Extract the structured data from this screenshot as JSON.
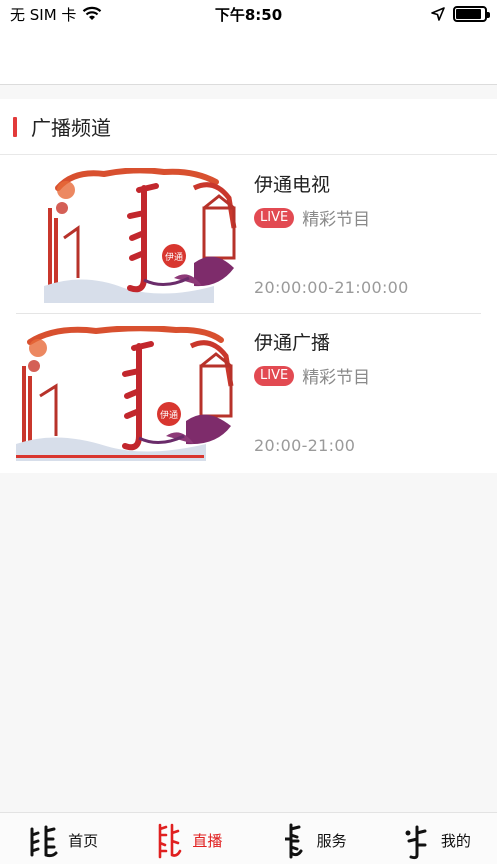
{
  "status": {
    "carrier": "无 SIM 卡",
    "time": "下午8:50",
    "battery_level": 0.9
  },
  "section": {
    "title": "广播频道"
  },
  "channels": [
    {
      "name": "伊通电视",
      "badge": "LIVE",
      "desc": "精彩节目",
      "time": "20:00:00-21:00:00",
      "thumb_seal": "伊通"
    },
    {
      "name": "伊通广播",
      "badge": "LIVE",
      "desc": "精彩节目",
      "time": "20:00-21:00",
      "thumb_seal": "伊通"
    }
  ],
  "tabs": [
    {
      "label": "首页",
      "icon": "mongolian-script-home-icon",
      "active": false
    },
    {
      "label": "直播",
      "icon": "mongolian-script-live-icon",
      "active": true
    },
    {
      "label": "服务",
      "icon": "mongolian-script-service-icon",
      "active": false
    },
    {
      "label": "我的",
      "icon": "mongolian-script-me-icon",
      "active": false
    }
  ],
  "colors": {
    "accent": "#e23a3a",
    "live_badge": "#e24a52",
    "active_tab": "#e02020"
  }
}
